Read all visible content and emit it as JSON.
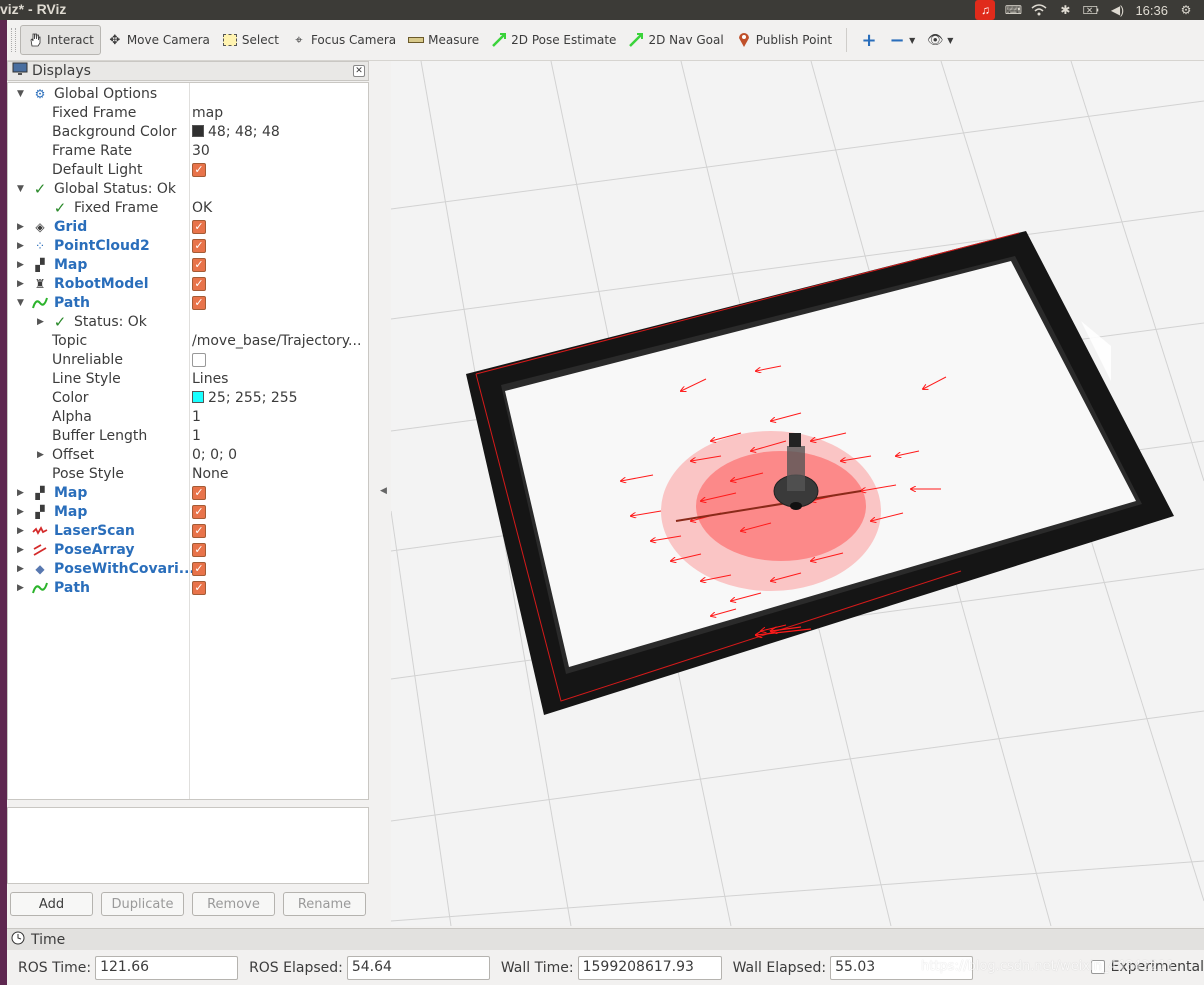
{
  "window": {
    "title": "viz* - RViz"
  },
  "tray": {
    "clock": "16:36",
    "keyboard": "⌨",
    "wifi": "wifi-icon",
    "bluetooth": "bluetooth-icon",
    "battery": "battery-icon",
    "volume": "volume-icon",
    "power": "power-icon"
  },
  "toolbar": {
    "tools": [
      {
        "label": "Interact",
        "icon": "hand-icon"
      },
      {
        "label": "Move Camera",
        "icon": "move-camera-icon"
      },
      {
        "label": "Select",
        "icon": "select-icon"
      },
      {
        "label": "Focus Camera",
        "icon": "focus-camera-icon"
      },
      {
        "label": "Measure",
        "icon": "measure-icon"
      },
      {
        "label": "2D Pose Estimate",
        "icon": "pose-estimate-icon"
      },
      {
        "label": "2D Nav Goal",
        "icon": "nav-goal-icon"
      },
      {
        "label": "Publish Point",
        "icon": "publish-point-icon"
      }
    ]
  },
  "displays": {
    "title": "Displays",
    "rows": {
      "global_options": "Global Options",
      "fixed_frame_label": "Fixed Frame",
      "fixed_frame_value": "map",
      "bg_color_label": "Background Color",
      "bg_color_value": "48; 48; 48",
      "frame_rate_label": "Frame Rate",
      "frame_rate_value": "30",
      "default_light_label": "Default Light",
      "global_status": "Global Status: Ok",
      "status_fixed_frame": "Fixed Frame",
      "status_fixed_frame_value": "OK",
      "grid": "Grid",
      "pointcloud2": "PointCloud2",
      "map1": "Map",
      "robotmodel": "RobotModel",
      "path": "Path",
      "path_status": "Status: Ok",
      "topic_label": "Topic",
      "topic_value": "/move_base/Trajectory...",
      "unreliable_label": "Unreliable",
      "line_style_label": "Line Style",
      "line_style_value": "Lines",
      "color_label": "Color",
      "color_value": "25; 255; 255",
      "alpha_label": "Alpha",
      "alpha_value": "1",
      "buffer_label": "Buffer Length",
      "buffer_value": "1",
      "offset_label": "Offset",
      "offset_value": "0; 0; 0",
      "pose_style_label": "Pose Style",
      "pose_style_value": "None",
      "map2": "Map",
      "map3": "Map",
      "laserscan": "LaserScan",
      "posearray": "PoseArray",
      "posewithcov": "PoseWithCovari...",
      "path2": "Path"
    },
    "buttons": {
      "add": "Add",
      "duplicate": "Duplicate",
      "remove": "Remove",
      "rename": "Rename"
    }
  },
  "colors": {
    "bg": "#303030",
    "path_color": "#19ffff",
    "accent_check": "#e8734a"
  },
  "time": {
    "title": "Time",
    "ros_time_label": "ROS Time:",
    "ros_time": "121.66",
    "ros_elapsed_label": "ROS Elapsed:",
    "ros_elapsed": "54.64",
    "wall_time_label": "Wall Time:",
    "wall_time": "1599208617.93",
    "wall_elapsed_label": "Wall Elapsed:",
    "wall_elapsed": "55.03",
    "experimental_label": "Experimental",
    "watermark": "https://blog.csdn.net/weixin_44842211"
  }
}
